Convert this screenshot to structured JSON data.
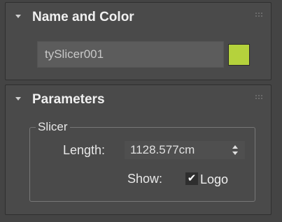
{
  "name_and_color": {
    "title": "Name and Color",
    "object_name": "tySlicer001",
    "swatch_color": "#b5d23c"
  },
  "parameters": {
    "title": "Parameters",
    "group_label": "Slicer",
    "length_label": "Length:",
    "length_value": "1128.577cm",
    "show_label": "Show:",
    "logo_label": "Logo",
    "logo_checked": true,
    "check_glyph": "✔"
  },
  "icons": {
    "collapse": "triangle-down-icon",
    "grip": "drag-grip-icon",
    "spinner": "spinner-arrows-icon"
  }
}
